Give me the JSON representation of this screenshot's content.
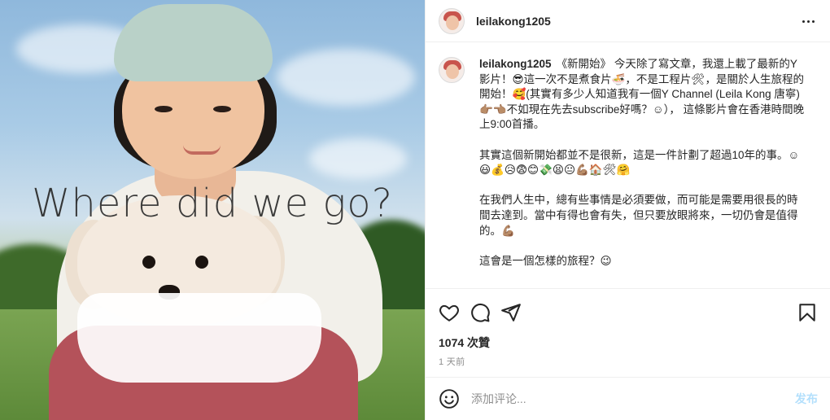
{
  "photo": {
    "overlay_text": "Where did we go?"
  },
  "header": {
    "username": "leilakong1205"
  },
  "caption": {
    "author": "leilakong1205",
    "paragraphs": [
      "《新開始》 今天除了寫文章，我還上載了最新的Y    影片！😎這一次不是煮食片🍜，不是工程片🛠，是關於人生旅程的開始！🥰(其實有多少人知道我有一個Y        Channel (Leila Kong 唐寧) 👉🏽👈🏽不如現在先去subscribe好嗎？☺）， 這條影片會在香港時間晚上9:00首播。",
      "其實這個新開始都並不是很新，這是一件計劃了超過10年的事。☺😃💰😥😨😊💸😫😐💪🏽🏠🛠🤗",
      "在我們人生中，總有些事情是必須要做，而可能是需要用很長的時間去達到。當中有得也會有失，但只要放眼將來，一切仍會是值得的。💪🏽",
      "這會是一個怎樣的旅程？😉"
    ]
  },
  "actions": {
    "likes": "1074 次贊",
    "time": "1 天前"
  },
  "comment": {
    "placeholder": "添加评论...",
    "post_label": "发布"
  }
}
